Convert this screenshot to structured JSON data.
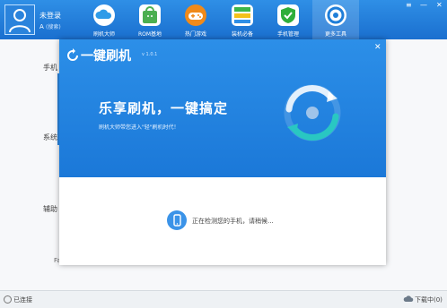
{
  "user": {
    "status": "未登录",
    "letter": "A",
    "note": "(搜索)"
  },
  "nav": [
    {
      "label": "刷机大师",
      "icon": "cloud-icon",
      "color": "#2f9be8"
    },
    {
      "label": "ROM基地",
      "icon": "android-bag-icon",
      "color": "#4caf50"
    },
    {
      "label": "热门游戏",
      "icon": "gamepad-icon",
      "color": "#f08a1a"
    },
    {
      "label": "装机必备",
      "icon": "apps-grid-icon",
      "color": "#3cb64a"
    },
    {
      "label": "手机管理",
      "icon": "shield-icon",
      "color": "#2fae3a"
    },
    {
      "label": "更多工具",
      "icon": "tools-gear-icon",
      "color": "#ffffff"
    }
  ],
  "window_controls": {
    "menu": "≡",
    "minimize": "—",
    "close": "✕"
  },
  "background": {
    "section1": "手机",
    "section2": "系统",
    "section3": "辅助",
    "fa_text": "Fa"
  },
  "dialog": {
    "title": "一键刷机",
    "version": "v 1.0.1",
    "close": "✕",
    "slogan": "乐享刷机，一键搞定",
    "subslogan": "刷机大师带您进入\"轻\"刷机时代！",
    "detect_text": "正在检测您的手机，请稍候..."
  },
  "status": {
    "connection": "已连接",
    "download": "下载中(0)"
  },
  "colors": {
    "accent": "#1e7ed8",
    "progress": "#29c7c2"
  }
}
